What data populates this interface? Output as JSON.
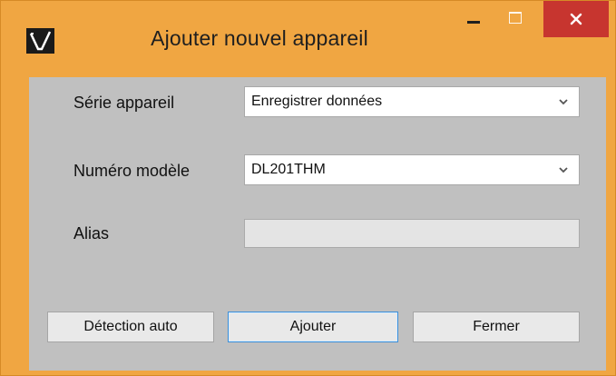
{
  "window": {
    "title": "Ajouter nouvel appareil",
    "controls": {
      "minimize": "minimize-icon",
      "maximize": "maximize-icon",
      "close": "close-icon"
    },
    "colors": {
      "frame": "#f0a642",
      "close_button": "#c7352f",
      "client": "#c0c0c0",
      "focus_border": "#3c8fd9"
    }
  },
  "form": {
    "serie_label": "Série appareil",
    "serie_value": "Enregistrer données",
    "modele_label": "Numéro modèle",
    "modele_value": "DL201THM",
    "alias_label": "Alias",
    "alias_value": ""
  },
  "buttons": {
    "detect": "Détection auto",
    "add": "Ajouter",
    "close": "Fermer"
  }
}
